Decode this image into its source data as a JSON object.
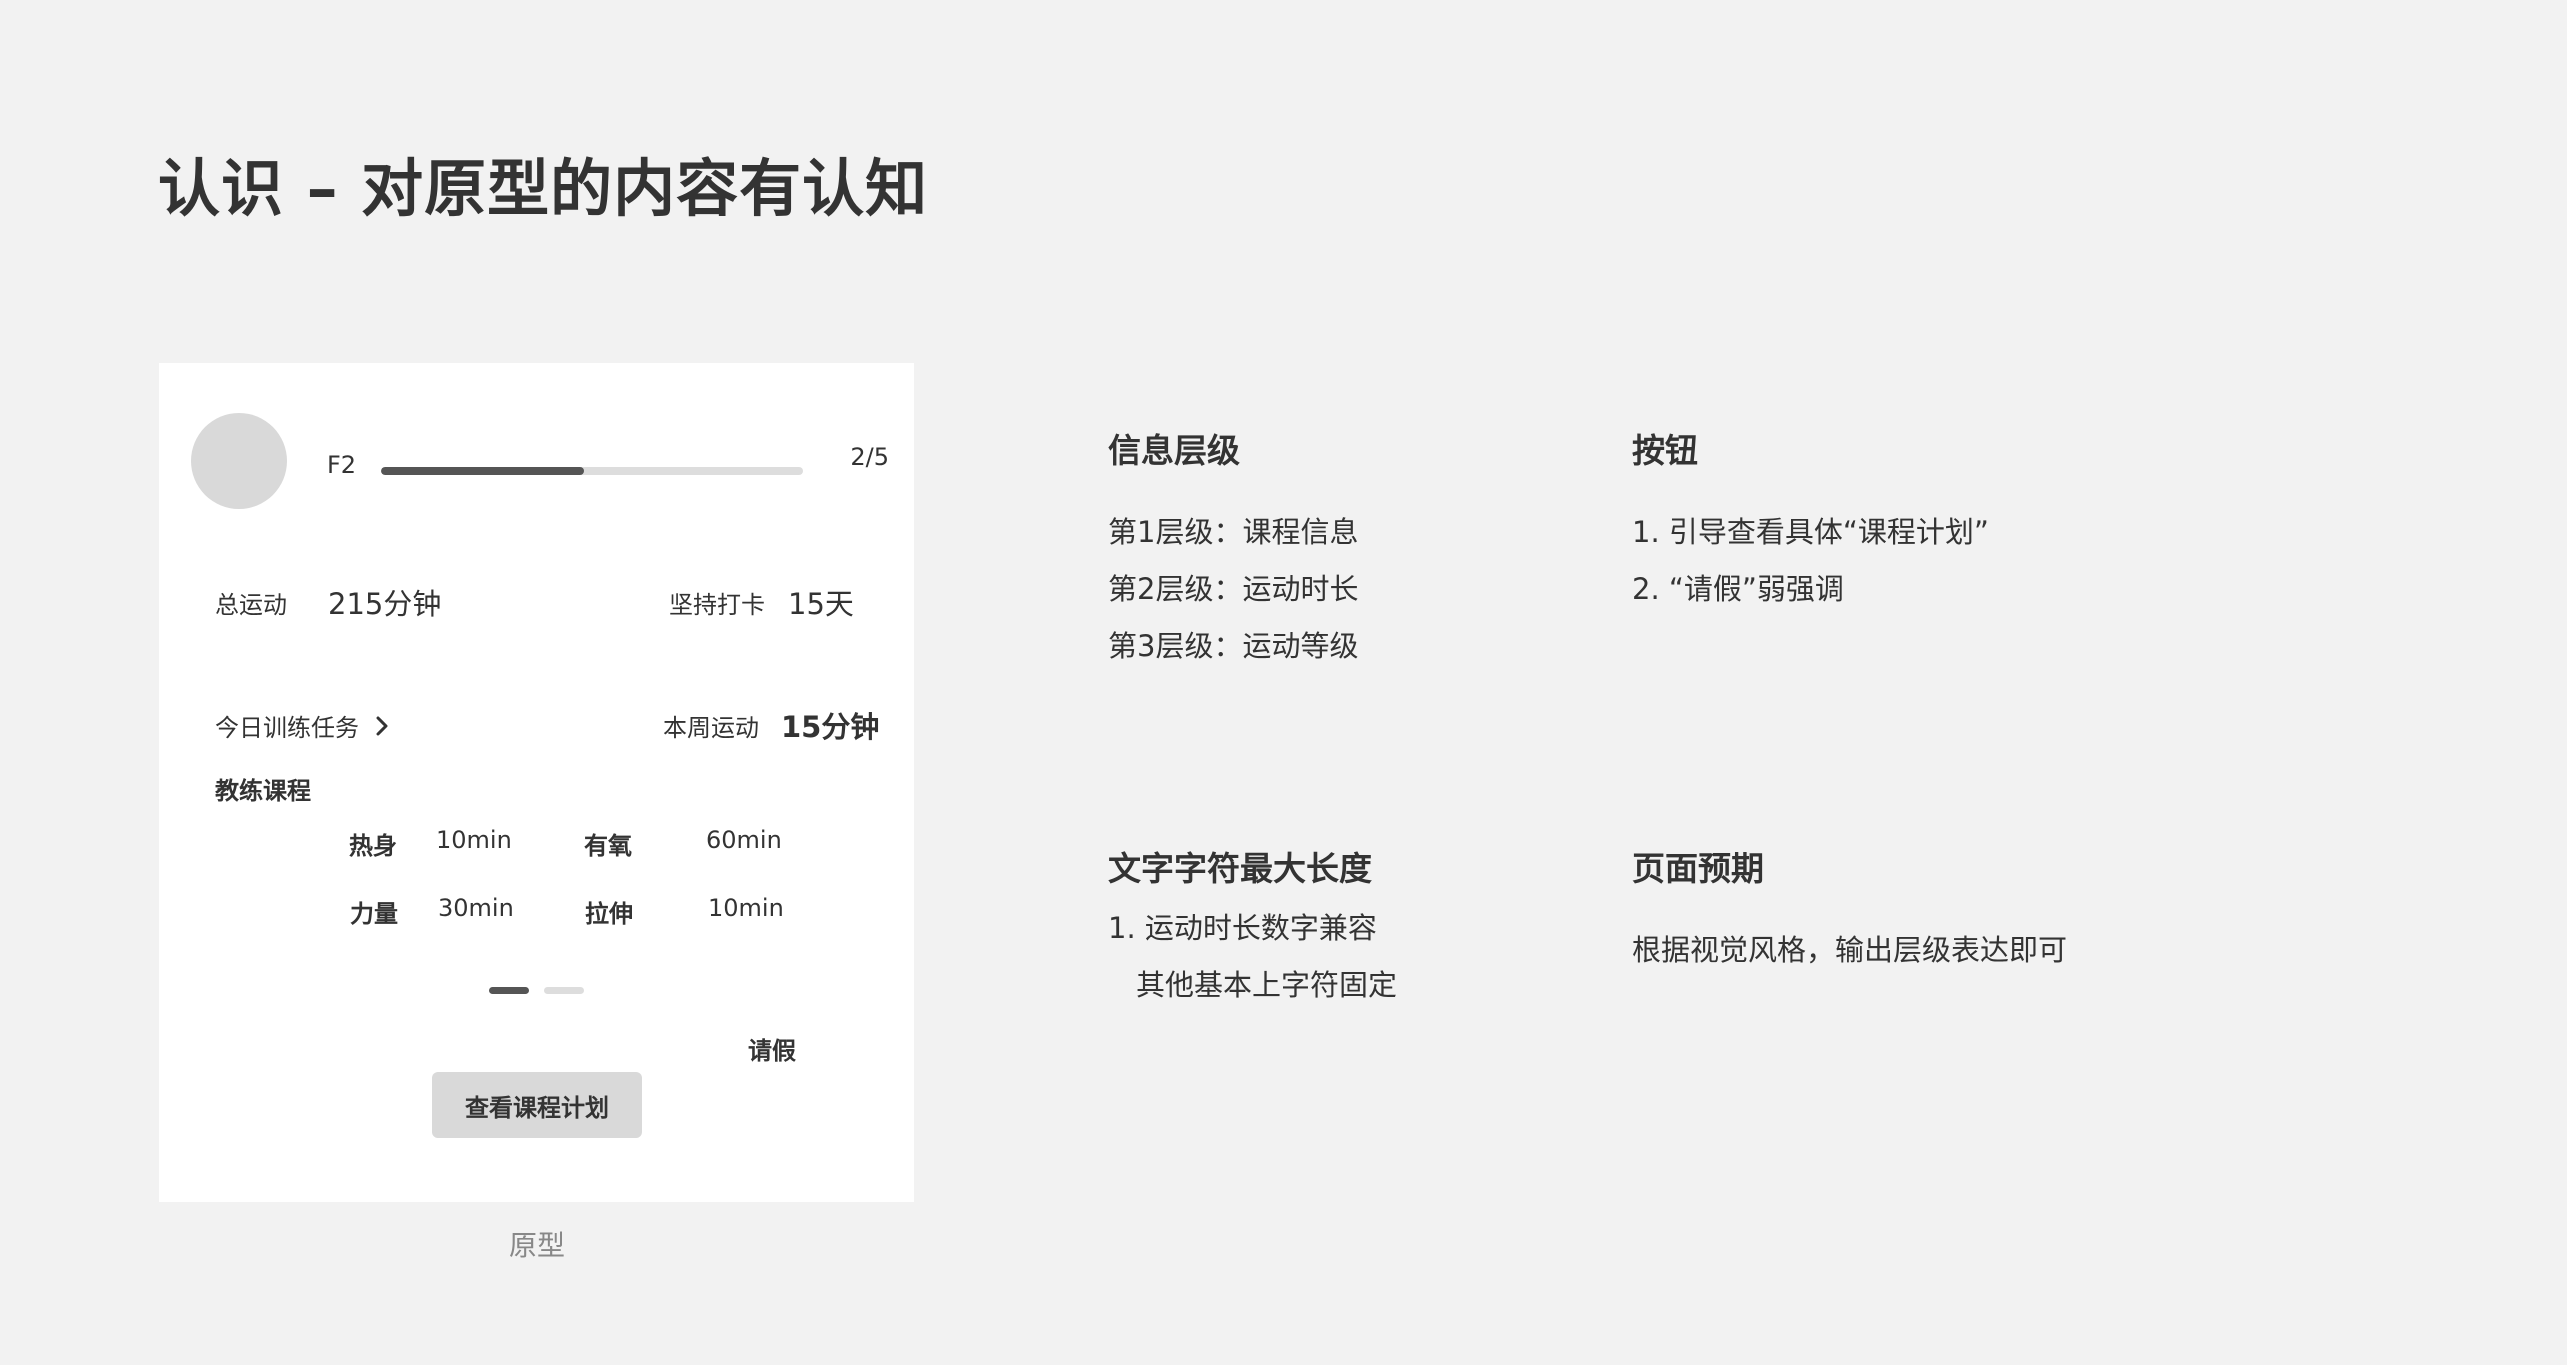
{
  "page_title": "认识 – 对原型的内容有认知",
  "prototype": {
    "level": "F2",
    "progress_text": "2/5",
    "progress_value": 0.48,
    "total_exercise_label": "总运动",
    "total_exercise_value": "215分钟",
    "checkin_label": "坚持打卡",
    "checkin_value": "15天",
    "today_task_label": "今日训练任务",
    "week_exercise_label": "本周运动",
    "week_exercise_value": "15分钟",
    "coach_course_label": "教练课程",
    "courses": [
      {
        "name": "热身",
        "value": "10min"
      },
      {
        "name": "有氧",
        "value": "60min"
      },
      {
        "name": "力量",
        "value": "30min"
      },
      {
        "name": "拉伸",
        "value": "10min"
      }
    ],
    "leave_label": "请假",
    "view_plan_label": "查看课程计划"
  },
  "caption": "原型",
  "sections": {
    "info_levels": {
      "title": "信息层级",
      "items": [
        "第1层级：课程信息",
        "第2层级：运动时长",
        "第3层级：运动等级"
      ]
    },
    "buttons": {
      "title": "按钮",
      "items": [
        "1. 引导查看具体“课程计划”",
        "2. “请假”弱强调"
      ]
    },
    "max_length": {
      "title": "文字字符最大长度",
      "items": [
        "1. 运动时长数字兼容",
        "其他基本上字符固定"
      ]
    },
    "page_expectation": {
      "title": "页面预期",
      "items": [
        "根据视觉风格，输出层级表达即可"
      ]
    }
  },
  "colors": {
    "background": "#f2f2f2",
    "card": "#ffffff",
    "text": "#333333",
    "muted": "#888888",
    "progress_fill": "#555555",
    "progress_track": "#dddddd",
    "button": "#d9d9d9"
  }
}
